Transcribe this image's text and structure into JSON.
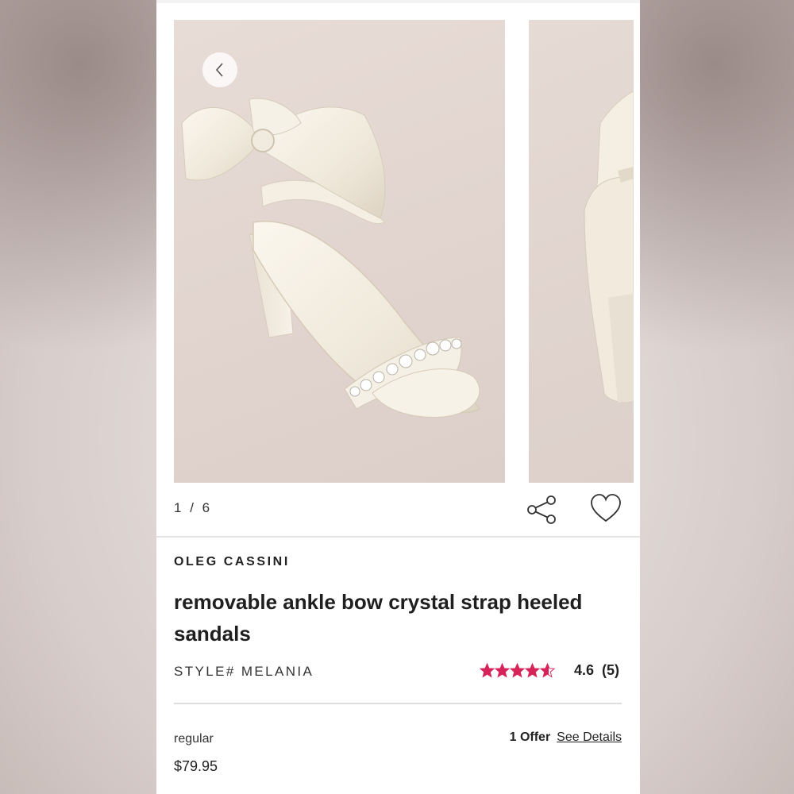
{
  "gallery": {
    "counter_current": "1",
    "counter_separator": "/",
    "counter_total": "6",
    "back_icon": "chevron-left-icon",
    "share_icon": "share-icon",
    "favorite_icon": "heart-icon"
  },
  "product": {
    "brand": "OLEG CASSINI",
    "title": "removable ankle bow crystal strap heeled sandals",
    "style_label": "STYLE# MELANIA",
    "rating_value": "4.6",
    "rating_count": "(5)",
    "rating_stars": 4.6,
    "price_label": "regular",
    "price": "$79.95",
    "offer_count": "1 Offer",
    "offer_link": "See Details"
  },
  "colors": {
    "star": "#d6245a",
    "text": "#1f1f1f",
    "card": "#ffffff"
  }
}
